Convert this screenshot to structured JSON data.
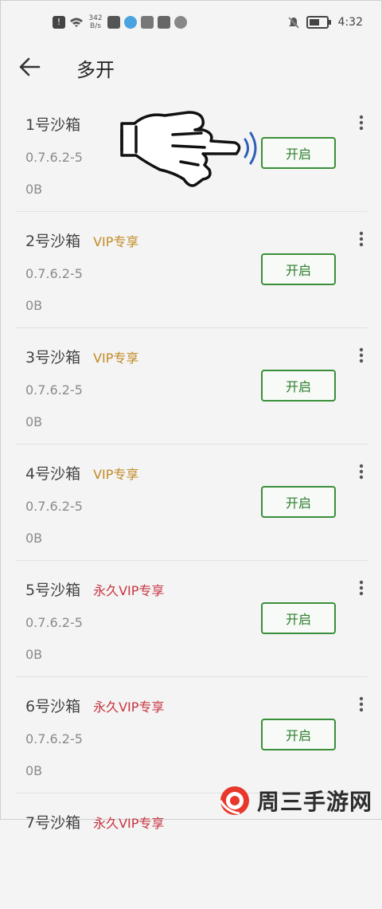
{
  "status_bar": {
    "net_speed": "342\nB/s",
    "time": "4:32"
  },
  "header": {
    "title": "多开"
  },
  "items": [
    {
      "name": "1号沙箱",
      "badge": "",
      "version": "0.7.6.2-5",
      "size": "0B",
      "button": "开启"
    },
    {
      "name": "2号沙箱",
      "badge": "VIP专享",
      "version": "0.7.6.2-5",
      "size": "0B",
      "button": "开启"
    },
    {
      "name": "3号沙箱",
      "badge": "VIP专享",
      "version": "0.7.6.2-5",
      "size": "0B",
      "button": "开启"
    },
    {
      "name": "4号沙箱",
      "badge": "VIP专享",
      "version": "0.7.6.2-5",
      "size": "0B",
      "button": "开启"
    },
    {
      "name": "5号沙箱",
      "badge": "永久VIP专享",
      "version": "0.7.6.2-5",
      "size": "0B",
      "button": "开启"
    },
    {
      "name": "6号沙箱",
      "badge": "永久VIP专享",
      "version": "0.7.6.2-5",
      "size": "0B",
      "button": "开启"
    },
    {
      "name": "7号沙箱",
      "badge": "永久VIP专享",
      "version": "",
      "size": "",
      "button": ""
    }
  ],
  "watermark": {
    "text": "周三手游网"
  },
  "colors": {
    "accent": "#2e7d2e",
    "vip": "#c18a24",
    "forever_vip": "#c7353f"
  }
}
